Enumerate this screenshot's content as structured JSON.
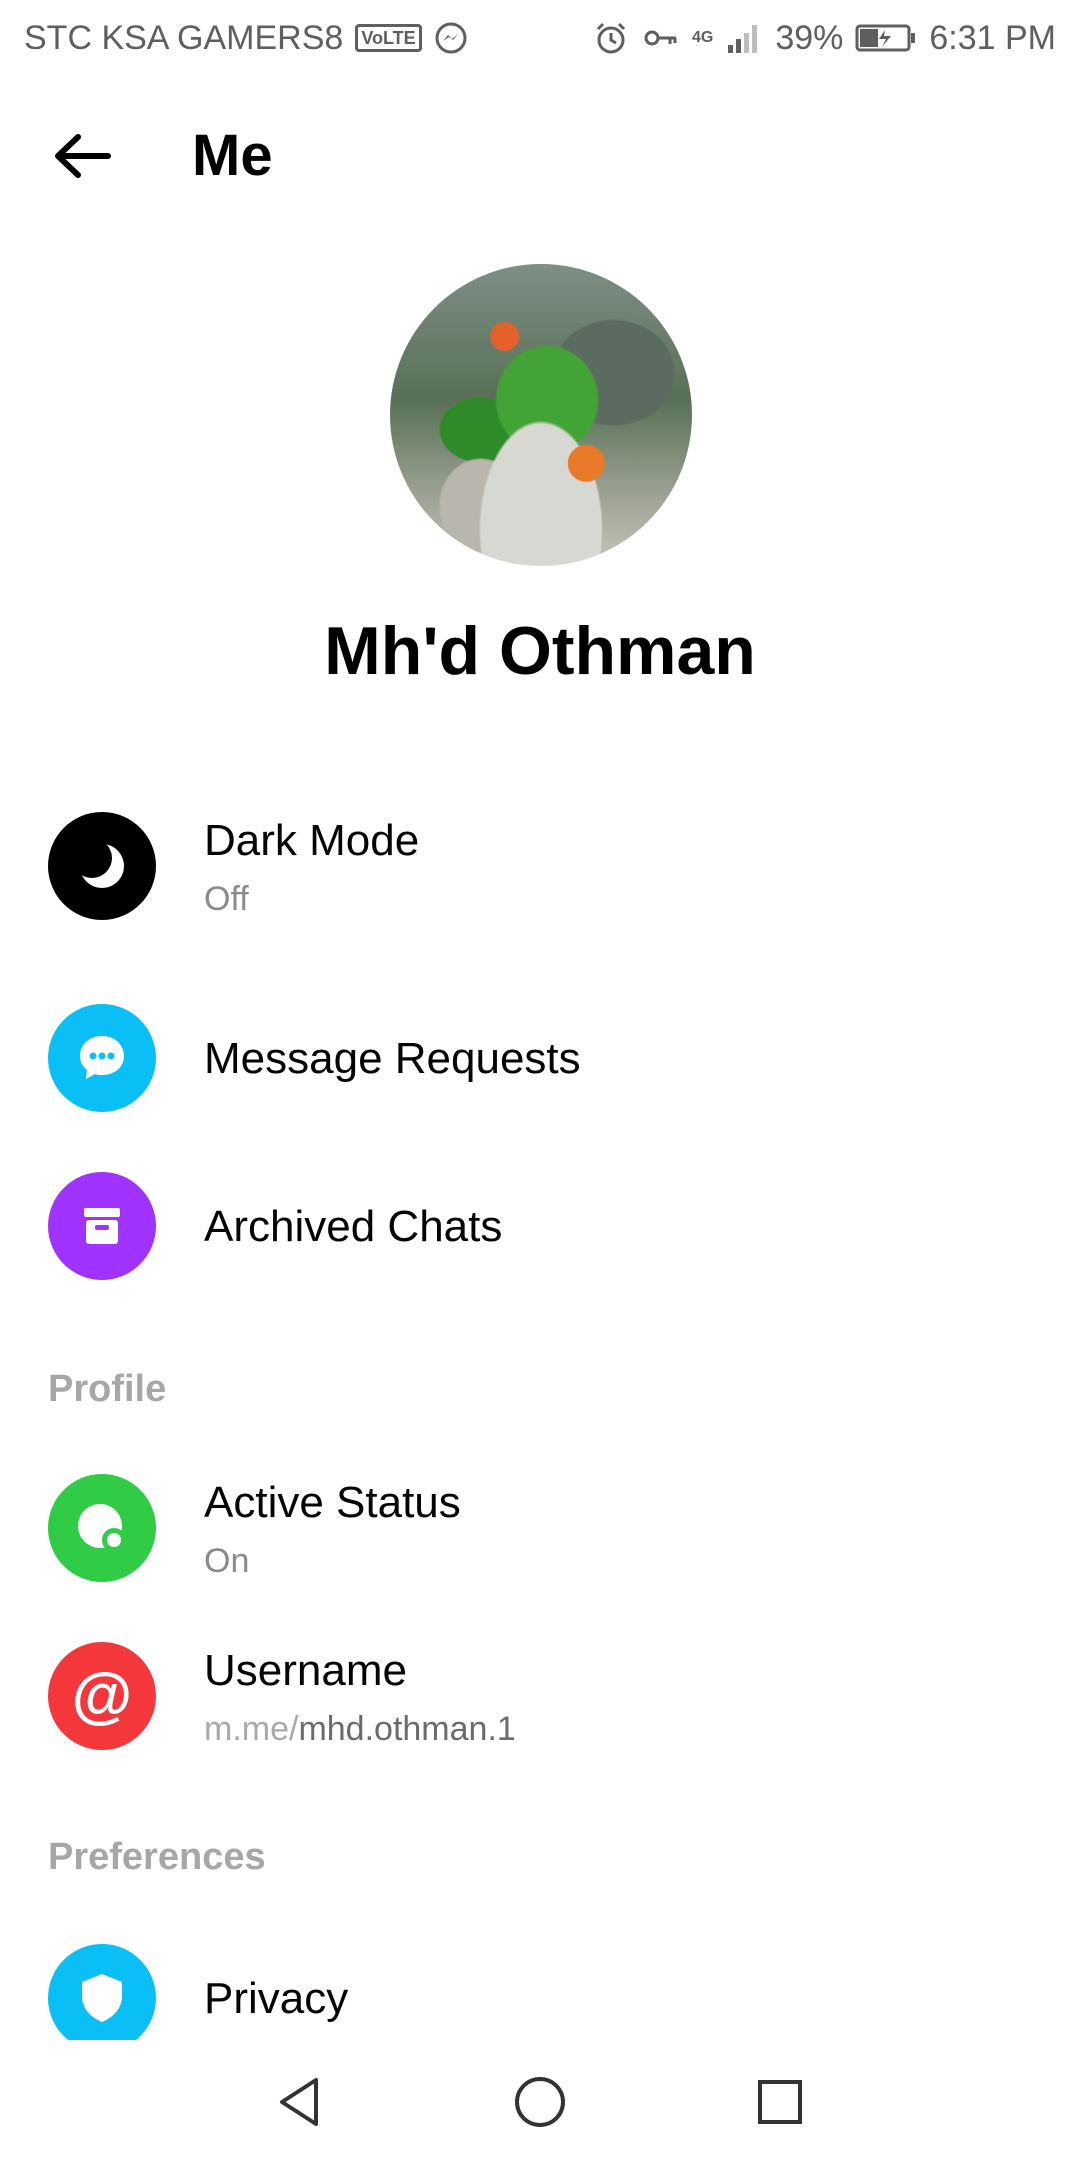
{
  "status_bar": {
    "carrier": "STC KSA GAMERS8",
    "volte": "VoLTE",
    "network": "4G",
    "battery": "39%",
    "time": "6:31 PM"
  },
  "header": {
    "title": "Me"
  },
  "profile": {
    "name": "Mh'd Othman"
  },
  "items": {
    "dark_mode": {
      "label": "Dark Mode",
      "value": "Off",
      "icon": "moon-icon",
      "color": "#000000"
    },
    "message_requests": {
      "label": "Message Requests",
      "icon": "chat-bubble-icon",
      "color": "#0ABFF5"
    },
    "archived_chats": {
      "label": "Archived Chats",
      "icon": "archive-box-icon",
      "color": "#A033FF"
    }
  },
  "sections": {
    "profile": {
      "title": "Profile",
      "active_status": {
        "label": "Active Status",
        "value": "On",
        "icon": "active-status-icon",
        "color": "#31CC46"
      },
      "username": {
        "label": "Username",
        "prefix": "m.me/",
        "value": "mhd.othman.1",
        "icon": "at-sign-icon",
        "color": "#F3373B"
      }
    },
    "preferences": {
      "title": "Preferences",
      "privacy": {
        "label": "Privacy",
        "icon": "shield-icon",
        "color": "#0ABFF5"
      }
    }
  }
}
